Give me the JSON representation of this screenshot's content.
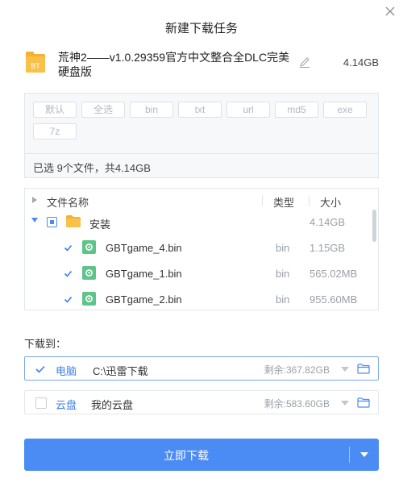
{
  "dialog": {
    "title": "新建下载任务"
  },
  "torrent": {
    "icon_text": "BT",
    "name": "荒神2——v1.0.29359官方中文整合全DLC完美硬盘版",
    "size": "4.14GB"
  },
  "filters": {
    "tags": [
      {
        "label": "默认",
        "on": true
      },
      {
        "label": "全选",
        "on": false
      },
      {
        "label": "bin",
        "on": true
      },
      {
        "label": "txt",
        "on": false
      },
      {
        "label": "url",
        "on": false
      },
      {
        "label": "md5",
        "on": false
      },
      {
        "label": "exe",
        "on": true
      },
      {
        "label": "7z",
        "on": true
      }
    ],
    "summary": "已选 9个文件，共4.14GB"
  },
  "file_list": {
    "columns": {
      "name": "文件名称",
      "type": "类型",
      "size": "大小"
    },
    "folder": {
      "name": "安装",
      "size": "4.14GB"
    },
    "files": [
      {
        "name": "GBTgame_4.bin",
        "type": "bin",
        "size": "1.15GB"
      },
      {
        "name": "GBTgame_1.bin",
        "type": "bin",
        "size": "565.02MB"
      },
      {
        "name": "GBTgame_2.bin",
        "type": "bin",
        "size": "955.60MB"
      }
    ]
  },
  "destination": {
    "label": "下载到：",
    "options": [
      {
        "name": "电脑",
        "path": "C:\\迅雷下载",
        "remaining": "剩余:367.82GB",
        "selected": true
      },
      {
        "name": "云盘",
        "path": "我的云盘",
        "remaining": "剩余:583.60GB",
        "selected": false
      }
    ]
  },
  "actions": {
    "download_now": "立即下载"
  },
  "colors": {
    "accent": "#4a8cf4",
    "folder": "#f7b130",
    "exe_icon": "#5fc48a"
  }
}
